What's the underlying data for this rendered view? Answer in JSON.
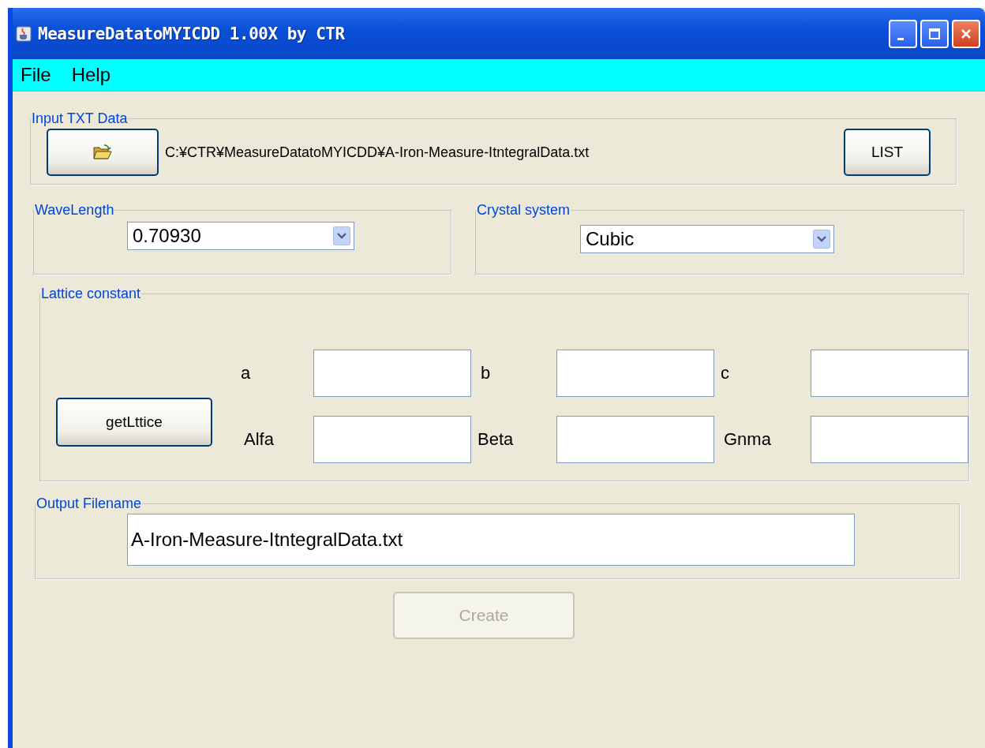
{
  "window": {
    "title": "MeasureDatatoMYICDD 1.00X by CTR"
  },
  "menu": [
    {
      "label": "File"
    },
    {
      "label": "Help"
    }
  ],
  "input_txt": {
    "legend": "Input TXT Data",
    "path": "C:¥CTR¥MeasureDatatoMYICDD¥A-Iron-Measure-ItntegralData.txt",
    "list_button": "LIST"
  },
  "wavelength": {
    "legend": "WaveLength",
    "value": "0.70930"
  },
  "crystal_system": {
    "legend": "Crystal system",
    "value": "Cubic"
  },
  "lattice": {
    "legend": "Lattice constant",
    "button": "getLttice",
    "fields": [
      {
        "label": "a"
      },
      {
        "label": "b"
      },
      {
        "label": "c"
      },
      {
        "label": "Alfa"
      },
      {
        "label": "Beta"
      },
      {
        "label": "Gnma"
      }
    ]
  },
  "output": {
    "legend": "Output Filename",
    "value": "A-Iron-Measure-ItntegralData.txt"
  },
  "create_button": {
    "label": "Create",
    "disabled": true
  }
}
